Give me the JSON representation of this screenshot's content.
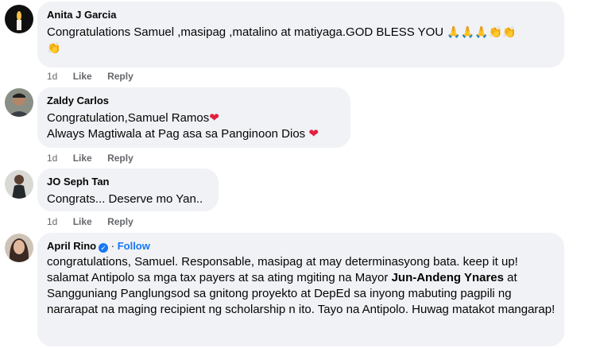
{
  "comments": [
    {
      "name": "Anita J Garcia",
      "lines": [
        "Congratulations Samuel ,masipag ,matalino at matiyaga.GOD BLESS YOU"
      ],
      "emojis_inline": "🙏🙏🙏👏👏",
      "emojis_next": "👏",
      "time": "1d",
      "like": "Like",
      "reply": "Reply"
    },
    {
      "name": "Zaldy Carlos",
      "lines": [
        "Congratulation,Samuel Ramos",
        "Always Magtiwala at Pag asa sa Panginoon Dios"
      ],
      "heart": "❤",
      "time": "1d",
      "like": "Like",
      "reply": "Reply"
    },
    {
      "name": "JO Seph Tan",
      "lines": [
        "Congrats... Deserve mo Yan.."
      ],
      "time": "1d",
      "like": "Like",
      "reply": "Reply"
    },
    {
      "name": "April Rino",
      "follow": "Follow",
      "separator": "·",
      "verified": "✓",
      "text_before": "congratulations, Samuel. Responsable, masipag at may determinasyong bata. keep it up! salamat Antipolo sa mga tax payers at sa ating mgiting na Mayor ",
      "text_bold": "Jun-Andeng Ynares",
      "text_after": " at Sangguniang Panglungsod sa gnitong proyekto at DepEd sa inyong mabuting pagpili ng nararapat na maging recipient ng scholarship n ito. Tayo na Antipolo. Huwag matakot mangarap!"
    }
  ],
  "colors": {
    "bubble": "#f0f2f5",
    "meta": "#65676b",
    "link": "#1877f2",
    "heart": "#e41e3f"
  }
}
